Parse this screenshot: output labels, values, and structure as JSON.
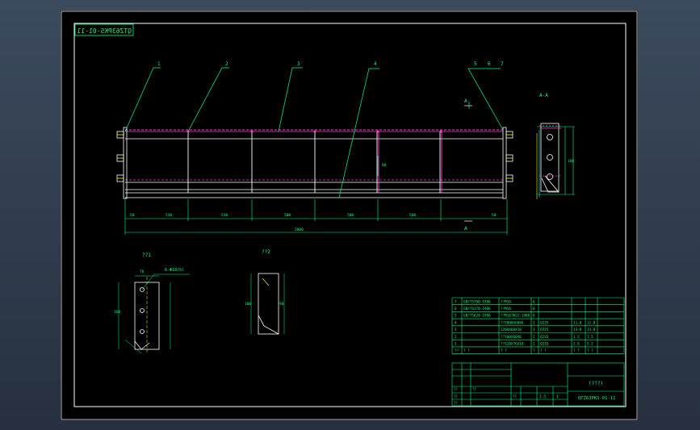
{
  "drawing_number_mirrored": "QTZ63PKS-01-11",
  "drawing_number": "QTZ63PKS-01-11",
  "section_label": "A-A",
  "section_mark": "A",
  "balloons": [
    "1",
    "2",
    "3",
    "4",
    "5",
    "6",
    "7"
  ],
  "dimensions": {
    "overall": "3000",
    "segments": [
      "50",
      "530",
      "530",
      "500",
      "500",
      "500",
      "50"
    ],
    "height": "80",
    "side_height": "188",
    "detail1_width": "76",
    "detail1_height": "160",
    "detail1_note": "6-Φ18(S)",
    "detail2_height": "100",
    "detail2_inner": "90"
  },
  "detail_labels": [
    "??1",
    "??2"
  ],
  "bom": {
    "rows": [
      {
        "no": "7",
        "code": "GB/T5780-1986",
        "name": "??M16",
        "qty": "6",
        "mat": "",
        "w1": "",
        "w2": ""
      },
      {
        "no": "6",
        "code": "GB/T6170-1986",
        "name": "??M16",
        "qty": "6",
        "mat": "",
        "w1": "",
        "w2": ""
      },
      {
        "no": "5",
        "code": "GB/T5620-1986",
        "name": "??M16?Ф22-1986",
        "qty": "6",
        "mat": "",
        "w1": "",
        "w2": ""
      },
      {
        "no": "4",
        "code": "",
        "name": "??2000X60X6",
        "qty": "1",
        "mat": "Q235",
        "w1": "11.8",
        "w2": "11.8"
      },
      {
        "no": "3",
        "code": "",
        "name": "1200X60X10",
        "qty": "1",
        "mat": "Q235",
        "w1": "13.8",
        "w2": "13.8"
      },
      {
        "no": "2",
        "code": "",
        "name": "??100X60X6",
        "qty": "5",
        "mat": "Q235",
        "w1": "1.5",
        "w2": "7.5"
      },
      {
        "no": "1",
        "code": "",
        "name": "??120X76X10",
        "qty": "2",
        "mat": "Q235",
        "w1": "2.6",
        "w2": "5.2"
      }
    ],
    "header": [
      "??",
      "?  ?",
      "?  ?",
      "?",
      "?  ?",
      "?  ?",
      "?  ?"
    ],
    "title_block": {
      "part_name": "(???)",
      "code": "QTZ63PKS-01-11",
      "scale": "1:5",
      "sheet": "1",
      "small_labels": [
        "??",
        "??",
        "??",
        "??",
        "??"
      ]
    }
  },
  "colors": {
    "line": "#ffffff",
    "dim": "#00ff7f",
    "cyan": "#00ffff",
    "magenta": "#ff3dd1",
    "yellow": "#ffff00",
    "frame": "#e8e8e8"
  }
}
